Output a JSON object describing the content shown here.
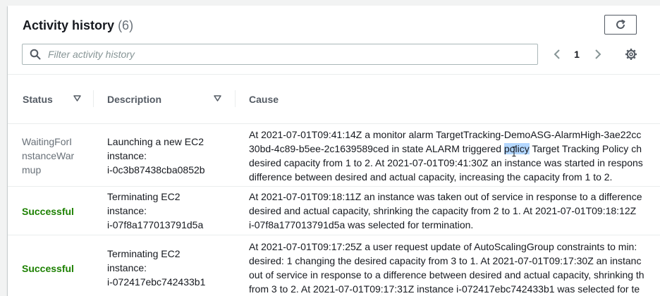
{
  "header": {
    "title": "Activity history",
    "count": "(6)"
  },
  "search": {
    "placeholder": "Filter activity history",
    "value": ""
  },
  "pagination": {
    "current_page": "1"
  },
  "table": {
    "columns": [
      "Status",
      "Description",
      "Cause"
    ],
    "rows": [
      {
        "status": "WaitingForInstanceWarmup",
        "status_lines": [
          "WaitingForI",
          "nstanceWar",
          "mup"
        ],
        "description_lines": [
          "Launching a new EC2",
          "instance:",
          "i-0c3b87438cba0852b"
        ],
        "cause_lines": [
          "At 2021-07-01T09:41:14Z a monitor alarm TargetTracking-DemoASG-AlarmHigh-3ae22cc",
          "30bd-4c89-b5ee-2c1639589ced in state ALARM triggered ",
          "policy",
          " Target Tracking Policy ch",
          "desired capacity from 1 to 2. At 2021-07-01T09:41:30Z an instance was started in respons",
          "difference between desired and actual capacity, increasing the capacity from 1 to 2."
        ]
      },
      {
        "status": "Successful",
        "description_lines": [
          "Terminating EC2",
          "instance:",
          "i-07f8a177013791d5a"
        ],
        "cause_lines": [
          "At 2021-07-01T09:18:11Z an instance was taken out of service in response to a difference",
          "desired and actual capacity, shrinking the capacity from 2 to 1. At 2021-07-01T09:18:12Z",
          "i-07f8a177013791d5a was selected for termination."
        ]
      },
      {
        "status": "Successful",
        "description_lines": [
          "Terminating EC2",
          "instance:",
          "i-072417ebc742433b1"
        ],
        "cause_lines": [
          "At 2021-07-01T09:17:25Z a user request update of AutoScalingGroup constraints to min:",
          "desired: 1 changing the desired capacity from 3 to 1. At 2021-07-01T09:17:30Z an instanc",
          "out of service in response to a difference between desired and actual capacity, shrinking th",
          "from 3 to 2. At 2021-07-01T09:17:31Z instance i-072417ebc742433b1 was selected for te"
        ]
      }
    ]
  },
  "icons": {
    "refresh": "refresh-icon",
    "search": "search-icon",
    "prev": "chevron-left-icon",
    "next": "chevron-right-icon",
    "settings": "gear-icon",
    "sort": "sort-caret-down-icon"
  },
  "colors": {
    "status_success": "#1d8102",
    "status_pending": "#687078",
    "text_highlight": "#b3d7ff"
  }
}
